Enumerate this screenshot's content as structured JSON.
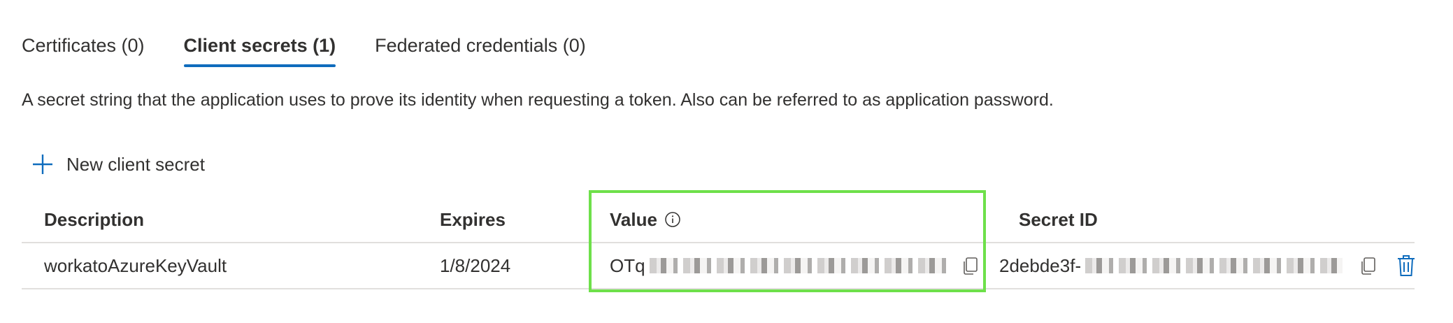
{
  "tabs": [
    {
      "label": "Certificates (0)",
      "active": false
    },
    {
      "label": "Client secrets (1)",
      "active": true
    },
    {
      "label": "Federated credentials (0)",
      "active": false
    }
  ],
  "description": "A secret string that the application uses to prove its identity when requesting a token. Also can be referred to as application password.",
  "toolbar": {
    "new_secret_label": "New client secret",
    "new_secret_icon": "plus-icon"
  },
  "table": {
    "headers": {
      "description": "Description",
      "expires": "Expires",
      "value": "Value",
      "secret_id": "Secret ID"
    },
    "rows": [
      {
        "description": "workatoAzureKeyVault",
        "expires": "1/8/2024",
        "value_visible_prefix": "OTq",
        "secret_id_visible_prefix": "2debde3f-"
      }
    ]
  },
  "colors": {
    "accent": "#0f6cbd",
    "highlight_border": "#6ee04a",
    "text": "#323130",
    "divider": "#e1dfdd"
  }
}
